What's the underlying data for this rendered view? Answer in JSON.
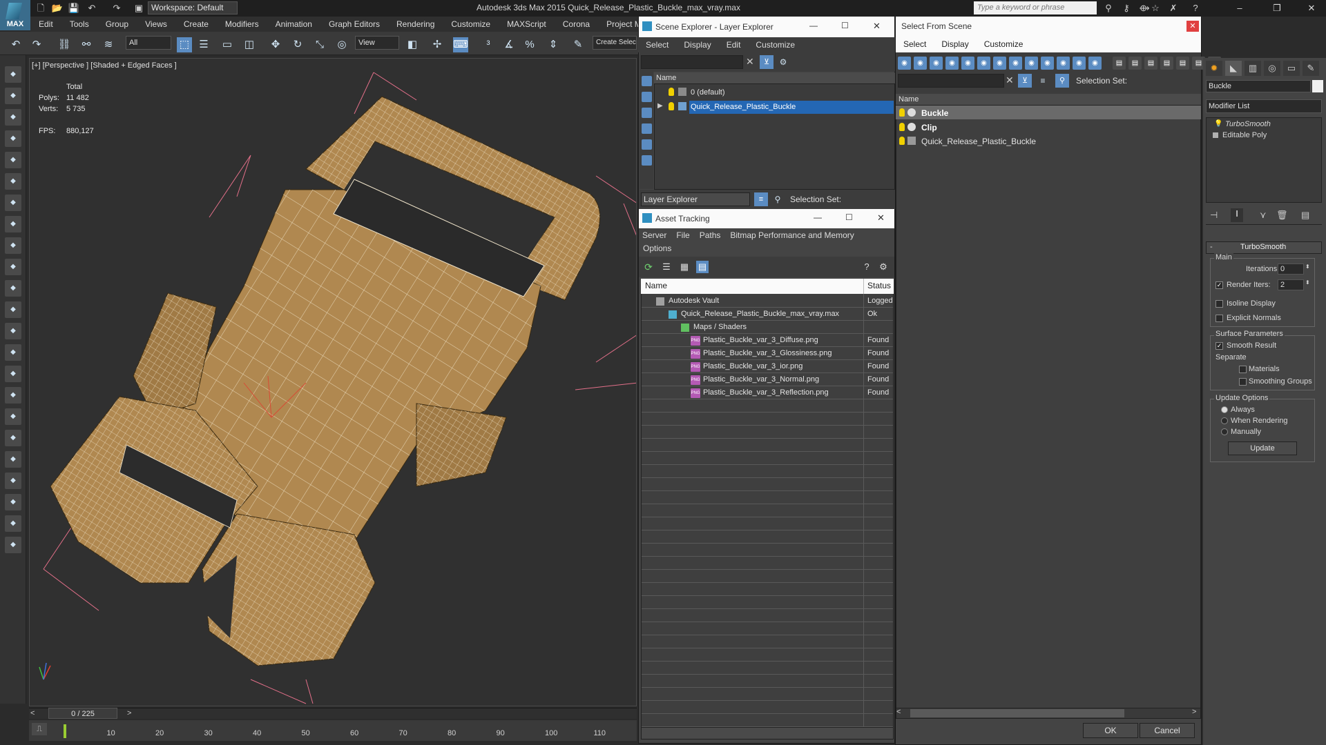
{
  "app": {
    "title": "Autodesk 3ds Max  2015     Quick_Release_Plastic_Buckle_max_vray.max",
    "logo_text": "MAX",
    "workspace": "Workspace: Default",
    "search_placeholder": "Type a keyword or phrase",
    "minimize": "–",
    "restore": "❐",
    "close": "✕"
  },
  "menu": [
    "Edit",
    "Tools",
    "Group",
    "Views",
    "Create",
    "Modifiers",
    "Animation",
    "Graph Editors",
    "Rendering",
    "Customize",
    "MAXScript",
    "Corona",
    "Project Man"
  ],
  "toolbar": {
    "filter_value": "All",
    "refcoord_value": "View",
    "selection_set_btn": "Create Selec"
  },
  "viewport": {
    "label": "[+] [Perspective ] [Shaded + Edged Faces ]",
    "stats_header": "Total",
    "polys_label": "Polys:",
    "polys_value": "11 482",
    "verts_label": "Verts:",
    "verts_value": "5 735",
    "fps_label": "FPS:",
    "fps_value": "880,127"
  },
  "timeline": {
    "frame_display": "0 / 225",
    "ticks": [
      "10",
      "20",
      "30",
      "40",
      "50",
      "60",
      "70",
      "80",
      "90",
      "100",
      "110"
    ]
  },
  "scene_explorer": {
    "title": "Scene Explorer - Layer Explorer",
    "menu": [
      "Select",
      "Display",
      "Edit",
      "Customize"
    ],
    "column": "Name",
    "rows": [
      "0 (default)",
      "Quick_Release_Plastic_Buckle"
    ],
    "footer_dropdown": "Layer Explorer",
    "footer_selset": "Selection Set:"
  },
  "asset_tracking": {
    "title": "Asset Tracking",
    "menu": [
      "Server",
      "File",
      "Paths",
      "Bitmap Performance and Memory"
    ],
    "menu2": "Options",
    "col_name": "Name",
    "col_status": "Status",
    "rows": [
      {
        "name": "Autodesk Vault",
        "status": "Logged"
      },
      {
        "name": "Quick_Release_Plastic_Buckle_max_vray.max",
        "status": "Ok"
      },
      {
        "name": "Maps / Shaders",
        "status": ""
      },
      {
        "name": "Plastic_Buckle_var_3_Diffuse.png",
        "status": "Found"
      },
      {
        "name": "Plastic_Buckle_var_3_Glossiness.png",
        "status": "Found"
      },
      {
        "name": "Plastic_Buckle_var_3_ior.png",
        "status": "Found"
      },
      {
        "name": "Plastic_Buckle_var_3_Normal.png",
        "status": "Found"
      },
      {
        "name": "Plastic_Buckle_var_3_Reflection.png",
        "status": "Found"
      }
    ],
    "png_badge": "PNG"
  },
  "select_from_scene": {
    "title": "Select From Scene",
    "menu": [
      "Select",
      "Display",
      "Customize"
    ],
    "selection_set": "Selection Set:",
    "column": "Name",
    "rows": [
      "Buckle",
      "Clip",
      "Quick_Release_Plastic_Buckle"
    ],
    "ok": "OK",
    "cancel": "Cancel"
  },
  "command_panel": {
    "object_name": "Buckle",
    "modifier_list": "Modifier List",
    "stack": [
      "TurboSmooth",
      "Editable Poly"
    ],
    "rollout_title": "TurboSmooth",
    "main_label": "Main",
    "iterations_label": "Iterations:",
    "iterations_value": "0",
    "render_iters_label": "Render Iters:",
    "render_iters_value": "2",
    "render_iters_checked": true,
    "isoline_label": "Isoline Display",
    "explicit_normals_label": "Explicit Normals",
    "surface_params_label": "Surface Parameters",
    "smooth_result_label": "Smooth Result",
    "separate_label": "Separate",
    "materials_label": "Materials",
    "smoothing_groups_label": "Smoothing Groups",
    "update_options_label": "Update Options",
    "always_label": "Always",
    "when_rendering_label": "When Rendering",
    "manually_label": "Manually",
    "update_button": "Update"
  },
  "colors": {
    "accent_blue": "#2467b4",
    "model_fill": "#b08850",
    "wire": "#f2e6cc"
  }
}
